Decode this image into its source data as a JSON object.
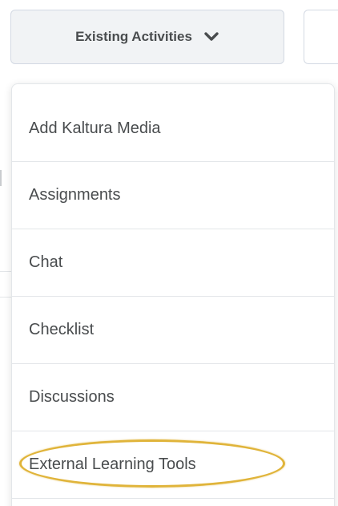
{
  "toolbar": {
    "existing_activities_label": "Existing Activities",
    "chevron_icon": "chevron-down-icon"
  },
  "menu": {
    "items": [
      {
        "label": "Add Kaltura Media"
      },
      {
        "label": "Assignments"
      },
      {
        "label": "Chat"
      },
      {
        "label": "Checklist"
      },
      {
        "label": "Discussions"
      },
      {
        "label": "External Learning Tools",
        "highlighted": true
      }
    ]
  },
  "colors": {
    "highlight_ring": "#e0b43a",
    "button_bg": "#f1f3f5",
    "text": "#494c4e",
    "divider": "#e3e6e9"
  }
}
